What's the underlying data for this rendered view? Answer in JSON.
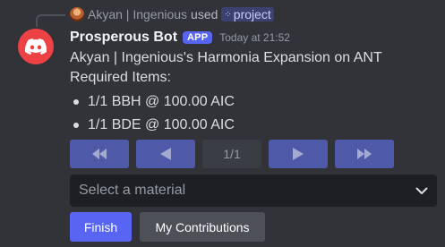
{
  "interaction": {
    "user": "Akyan | Ingenious",
    "verb": "used",
    "command": "project"
  },
  "message": {
    "author": "Prosperous Bot",
    "tag": "APP",
    "timestamp": "Today at 21:52",
    "title_line": "Akyan | Ingenious's Harmonia Expansion on ANT",
    "section_label": "Required Items:",
    "items": [
      "1/1 BBH @ 100.00 AIC",
      "1/1 BDE @ 100.00 AIC"
    ]
  },
  "pagination": {
    "indicator": "1/1",
    "buttons": [
      "first-page-icon",
      "prev-page-icon",
      "next-page-icon",
      "last-page-icon"
    ]
  },
  "select": {
    "placeholder": "Select a material"
  },
  "actions": {
    "finish": "Finish",
    "contributions": "My Contributions"
  },
  "colors": {
    "background": "#313338",
    "blurple": "#5865f2",
    "nav_button": "#4e5aa8",
    "discord_red": "#ed4245"
  }
}
